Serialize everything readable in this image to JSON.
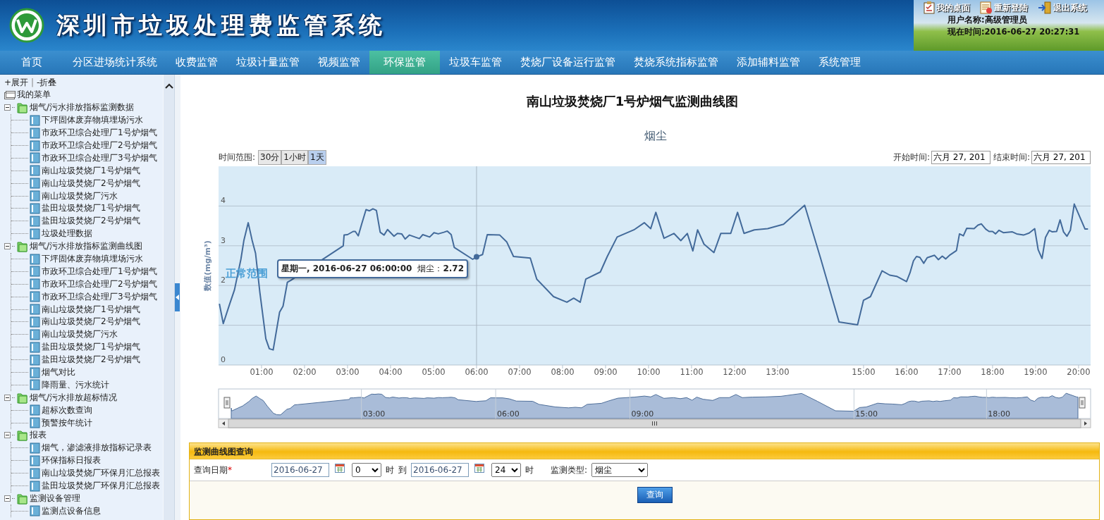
{
  "header": {
    "title": "深圳市垃圾处理费监管系统",
    "links": [
      {
        "label": "我的桌面",
        "kind": "desktop"
      },
      {
        "label": "重新登陆",
        "kind": "relogin"
      },
      {
        "label": "退出系统",
        "kind": "exit"
      }
    ],
    "user": "用户名称:高级管理员",
    "time": "现在时间:2016-06-27 20:27:31"
  },
  "nav": {
    "items": [
      {
        "label": "首页",
        "selected": false
      },
      {
        "label": "分区进场统计系统",
        "selected": false
      },
      {
        "label": "收费监管",
        "selected": false
      },
      {
        "label": "垃圾计量监管",
        "selected": false
      },
      {
        "label": "视频监管",
        "selected": false
      },
      {
        "label": "环保监管",
        "selected": true
      },
      {
        "label": "垃圾车监管",
        "selected": false
      },
      {
        "label": "焚烧厂设备运行监管",
        "selected": false
      },
      {
        "label": "焚烧系统指标监管",
        "selected": false
      },
      {
        "label": "添加辅料监管",
        "selected": false
      },
      {
        "label": "系统管理",
        "selected": false
      }
    ]
  },
  "sidebar": {
    "expand": "+展开",
    "separator": "|",
    "collapse": "-折叠",
    "menu": {
      "label": "我的菜单",
      "children": [
        {
          "label": "烟气/污水排放指标监测数据",
          "expanded": true,
          "children": [
            {
              "label": "下坪固体废弃物填埋场污水"
            },
            {
              "label": "市政环卫综合处理厂1号炉烟气"
            },
            {
              "label": "市政环卫综合处理厂2号炉烟气"
            },
            {
              "label": "市政环卫综合处理厂3号炉烟气"
            },
            {
              "label": "南山垃圾焚烧厂1号炉烟气"
            },
            {
              "label": "南山垃圾焚烧厂2号炉烟气"
            },
            {
              "label": "南山垃圾焚烧厂污水"
            },
            {
              "label": "盐田垃圾焚烧厂1号炉烟气"
            },
            {
              "label": "盐田垃圾焚烧厂2号炉烟气"
            },
            {
              "label": "垃圾处理数据"
            }
          ]
        },
        {
          "label": "烟气/污水排放指标监测曲线图",
          "expanded": true,
          "children": [
            {
              "label": "下坪固体废弃物填埋场污水"
            },
            {
              "label": "市政环卫综合处理厂1号炉烟气"
            },
            {
              "label": "市政环卫综合处理厂2号炉烟气"
            },
            {
              "label": "市政环卫综合处理厂3号炉烟气"
            },
            {
              "label": "南山垃圾焚烧厂1号炉烟气"
            },
            {
              "label": "南山垃圾焚烧厂2号炉烟气"
            },
            {
              "label": "南山垃圾焚烧厂污水"
            },
            {
              "label": "盐田垃圾焚烧厂1号炉烟气"
            },
            {
              "label": "盐田垃圾焚烧厂2号炉烟气"
            },
            {
              "label": "烟气对比"
            },
            {
              "label": "降雨量、污水统计"
            }
          ]
        },
        {
          "label": "烟气/污水排放超标情况",
          "expanded": true,
          "children": [
            {
              "label": "超标次数查询"
            },
            {
              "label": "预警按年统计"
            }
          ]
        },
        {
          "label": "报表",
          "expanded": true,
          "children": [
            {
              "label": "烟气，渗滤液排放指标记录表"
            },
            {
              "label": "环保指标日报表"
            },
            {
              "label": "南山垃圾焚烧厂环保月汇总报表"
            },
            {
              "label": "盐田垃圾焚烧厂环保月汇总报表"
            }
          ]
        },
        {
          "label": "监测设备管理",
          "expanded": true,
          "children": [
            {
              "label": "监测点设备信息"
            }
          ]
        }
      ]
    }
  },
  "page_title": "南山垃圾焚烧厂1号炉烟气监测曲线图",
  "chart": {
    "range_label": "时间范围:",
    "ranges": [
      {
        "label": "30分",
        "selected": false
      },
      {
        "label": "1小时",
        "selected": false
      },
      {
        "label": "1天",
        "selected": true
      }
    ],
    "start_label": "开始时间:",
    "start_value": "六月 27, 201",
    "end_label": "结束时间:",
    "end_value": "六月 27, 201",
    "tooltip": {
      "time": "星期一, 2016-06-27 06:00:00",
      "separator": "：",
      "value": "2.72"
    },
    "chart_data": {
      "type": "line",
      "title": "烟尘",
      "ylabel": "数值(mg/m³)",
      "xlim": [
        0,
        20.28
      ],
      "grid": true,
      "x": [
        0.02,
        0.11,
        0.26,
        0.37,
        0.52,
        0.59,
        0.69,
        0.78,
        0.86,
        0.96,
        1.1,
        1.18,
        1.27,
        1.42,
        1.5,
        1.6,
        1.68,
        2.9,
        2.92,
        3.0,
        3.13,
        3.18,
        3.25,
        3.33,
        3.43,
        3.51,
        3.59,
        3.67,
        3.76,
        3.85,
        3.93,
        4.08,
        4.16,
        4.26,
        4.34,
        4.44,
        4.67,
        4.75,
        4.91,
        5.01,
        5.11,
        5.24,
        5.32,
        5.41,
        5.48,
        5.91,
        6.0,
        6.14,
        6.25,
        6.54,
        6.7,
        6.86,
        7.25,
        7.4,
        7.79,
        8.1,
        8.26,
        8.41,
        8.54,
        8.88,
        9.04,
        9.27,
        9.66,
        9.9,
        10.05,
        10.17,
        10.36,
        10.59,
        10.75,
        10.9,
        11.03,
        11.14,
        11.29,
        11.52,
        11.68,
        11.91,
        12.07,
        12.22,
        12.46,
        12.77,
        13.14,
        13.63,
        14.0,
        14.43,
        14.86,
        15.0,
        15.16,
        15.43,
        15.61,
        15.77,
        16.0,
        16.08,
        16.16,
        16.23,
        16.31,
        16.4,
        16.48,
        16.65,
        16.74,
        16.83,
        16.91,
        17.01,
        17.16,
        17.23,
        17.32,
        17.4,
        17.57,
        17.66,
        17.74,
        17.84,
        17.92,
        18.0,
        18.07,
        18.15,
        18.25,
        18.46,
        18.56,
        18.72,
        18.85,
        18.98,
        19.06,
        19.15,
        19.23,
        19.32,
        19.39,
        19.49,
        19.57,
        19.65,
        19.73,
        19.81,
        19.9,
        20.15,
        20.22
      ],
      "series": [
        {
          "name": "烟尘",
          "color": "#436a9a",
          "values": [
            1.54,
            1.04,
            1.54,
            1.89,
            2.66,
            3.14,
            3.58,
            3.14,
            2.81,
            1.83,
            0.66,
            0.41,
            0.38,
            1.33,
            1.48,
            2.08,
            2.13,
            3.0,
            3.27,
            3.28,
            3.36,
            3.36,
            3.25,
            3.55,
            3.91,
            3.88,
            3.93,
            3.89,
            3.34,
            3.27,
            3.41,
            3.24,
            3.31,
            3.3,
            3.17,
            3.27,
            3.18,
            3.28,
            3.22,
            3.33,
            3.3,
            3.34,
            3.37,
            3.28,
            2.96,
            2.66,
            2.72,
            2.78,
            3.28,
            3.27,
            3.1,
            2.73,
            2.69,
            2.16,
            1.72,
            1.58,
            1.68,
            1.58,
            2.16,
            2.34,
            2.73,
            3.22,
            3.4,
            3.58,
            3.43,
            3.84,
            3.19,
            3.31,
            3.13,
            3.31,
            2.87,
            3.4,
            3.04,
            2.83,
            3.31,
            3.31,
            3.84,
            3.31,
            3.4,
            3.43,
            3.54,
            4.02,
            2.69,
            1.08,
            1.01,
            1.63,
            1.72,
            2.37,
            2.26,
            2.23,
            2.1,
            2.32,
            2.62,
            2.73,
            2.71,
            2.56,
            2.7,
            2.76,
            2.65,
            2.74,
            2.67,
            2.77,
            2.88,
            3.3,
            3.25,
            3.44,
            3.43,
            3.52,
            3.55,
            3.42,
            3.36,
            3.36,
            3.3,
            3.39,
            3.33,
            3.35,
            3.3,
            3.27,
            3.32,
            3.43,
            2.9,
            2.68,
            3.21,
            3.39,
            3.35,
            3.36,
            3.65,
            3.35,
            3.24,
            3.39,
            4.05,
            3.42,
            3.42
          ]
        }
      ],
      "ylim": [
        0,
        5
      ],
      "yticks": [
        0,
        2,
        3,
        4
      ],
      "xticks": [
        {
          "value": 1,
          "label": "01:00"
        },
        {
          "value": 2,
          "label": "02:00"
        },
        {
          "value": 3,
          "label": "03:00"
        },
        {
          "value": 4,
          "label": "04:00"
        },
        {
          "value": 5,
          "label": "05:00"
        },
        {
          "value": 6,
          "label": "06:00"
        },
        {
          "value": 7,
          "label": "07:00"
        },
        {
          "value": 8,
          "label": "08:00"
        },
        {
          "value": 9,
          "label": "09:00"
        },
        {
          "value": 10,
          "label": "10:00"
        },
        {
          "value": 11,
          "label": "11:00"
        },
        {
          "value": 12,
          "label": "12:00"
        },
        {
          "value": 13,
          "label": "13:00"
        },
        {
          "value": 15,
          "label": "15:00"
        },
        {
          "value": 16,
          "label": "16:00"
        },
        {
          "value": 17,
          "label": "17:00"
        },
        {
          "value": 18,
          "label": "18:00"
        },
        {
          "value": 19,
          "label": "19:00"
        },
        {
          "value": 20,
          "label": "20:00"
        }
      ],
      "ref_lines": [
        {
          "axis": "x",
          "value": 6.0
        }
      ],
      "annotations": [
        "正常范围"
      ]
    },
    "navigator": {
      "labels": [
        "03:00",
        "06:00",
        "09:00",
        "15:00",
        "18:00"
      ]
    }
  },
  "query": {
    "title": "监测曲线图查询",
    "date_label": "查询日期",
    "required_mark": "*",
    "from_date": "2016-06-27",
    "from_hour": "0",
    "hour_unit_1": "时",
    "to": "到",
    "to_date": "2016-06-27",
    "to_hour": "24",
    "hour_unit_2": "时",
    "type_label": "监测类型:",
    "type_value": "烟尘",
    "submit": "查询"
  }
}
